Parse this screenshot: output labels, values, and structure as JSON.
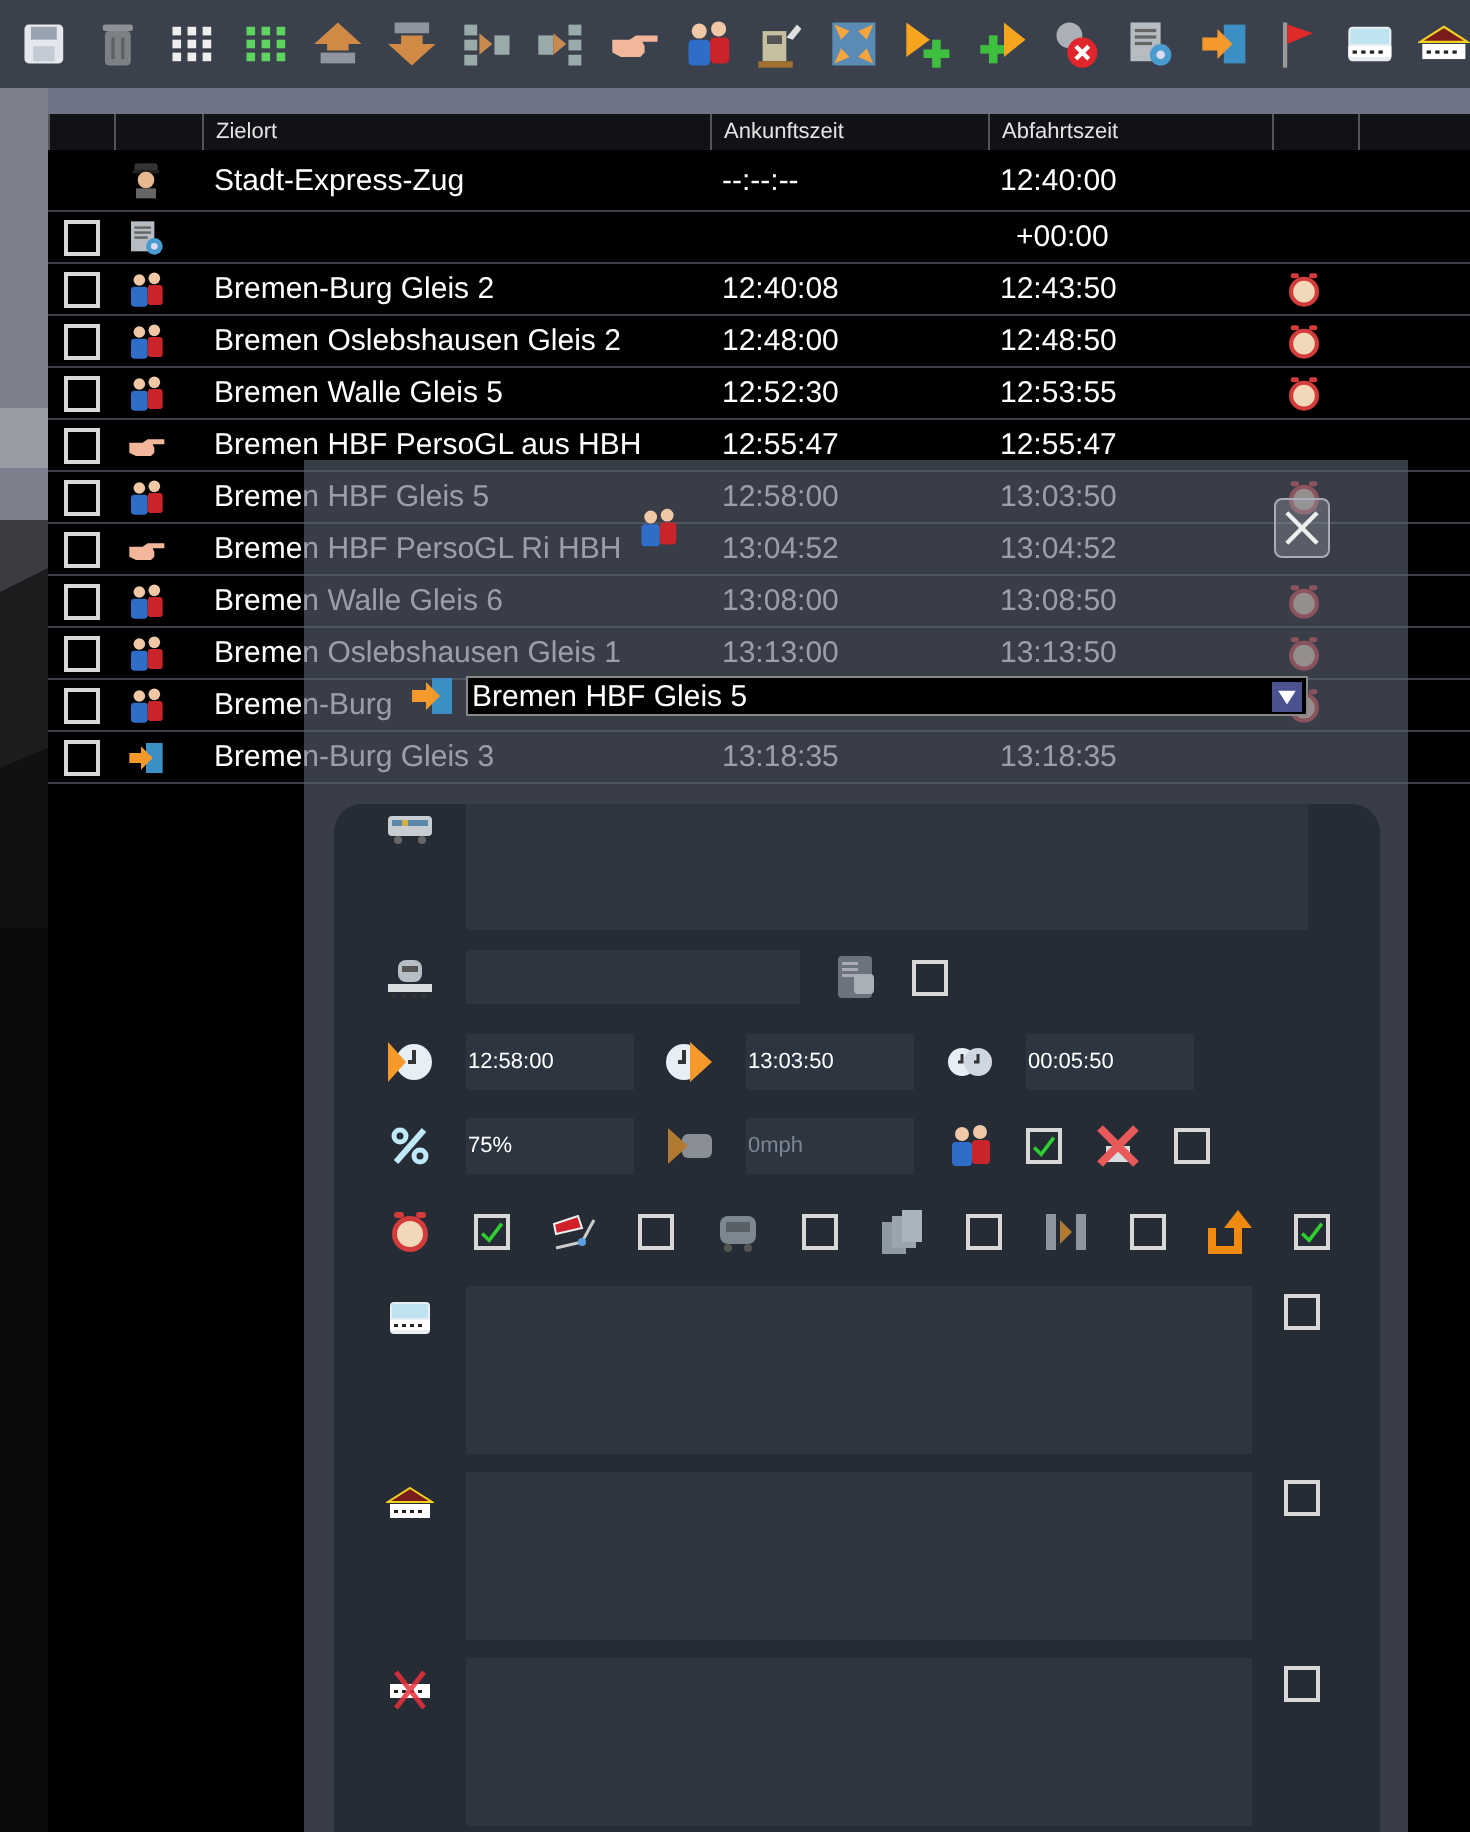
{
  "table": {
    "columns": [
      "Zielort",
      "Ankunftszeit",
      "Abfahrtszeit"
    ],
    "rows": [
      {
        "kind": "train",
        "destination": "Stadt-Express-Zug",
        "arrival": "--:--:--",
        "departure": "12:40:00",
        "alarm": false
      },
      {
        "kind": "settings",
        "checked": false,
        "departure": "+00:00",
        "alarm": false
      },
      {
        "kind": "passengers",
        "checked": false,
        "destination": "Bremen-Burg Gleis 2",
        "arrival": "12:40:08",
        "departure": "12:43:50",
        "alarm": true
      },
      {
        "kind": "passengers",
        "checked": false,
        "destination": "Bremen Oslebshausen Gleis 2",
        "arrival": "12:48:00",
        "departure": "12:48:50",
        "alarm": true
      },
      {
        "kind": "passengers",
        "checked": false,
        "destination": "Bremen Walle Gleis 5",
        "arrival": "12:52:30",
        "departure": "12:53:55",
        "alarm": true
      },
      {
        "kind": "pointer",
        "checked": false,
        "destination": "Bremen HBF PersoGL aus HBH",
        "arrival": "12:55:47",
        "departure": "12:55:47",
        "alarm": false
      },
      {
        "kind": "passengers",
        "checked": false,
        "destination": "Bremen HBF Gleis 5",
        "arrival": "12:58:00",
        "departure": "13:03:50",
        "alarm": true
      },
      {
        "kind": "pointer",
        "checked": false,
        "destination": "Bremen HBF PersoGL Ri HBH",
        "arrival": "13:04:52",
        "departure": "13:04:52",
        "alarm": false
      },
      {
        "kind": "passengers",
        "checked": false,
        "destination": "Bremen Walle Gleis 6",
        "arrival": "13:08:00",
        "departure": "13:08:50",
        "alarm": true
      },
      {
        "kind": "passengers",
        "checked": false,
        "destination": "Bremen Oslebshausen Gleis 1",
        "arrival": "13:13:00",
        "departure": "13:13:50",
        "alarm": true
      },
      {
        "kind": "passengers",
        "checked": false,
        "destination": "Bremen-Burg",
        "alarm": true
      },
      {
        "kind": "exit",
        "checked": false,
        "destination": "Bremen-Burg Gleis 3",
        "arrival": "13:18:35",
        "departure": "13:18:35",
        "alarm": false
      }
    ]
  },
  "panel": {
    "destination": {
      "value": "Bremen HBF Gleis 5"
    },
    "times": [
      {
        "kind": "arrival",
        "value": "12:58:00"
      },
      {
        "kind": "departure",
        "value": "13:03:50"
      },
      {
        "kind": "duration",
        "value": "00:05:50"
      }
    ],
    "percent": {
      "value": "75%"
    },
    "speed": {
      "placeholder": "0mph"
    },
    "flags": [
      {
        "kind": "composition",
        "checked": false
      },
      {
        "kind": "passengers",
        "checked": true
      },
      {
        "kind": "cancel",
        "checked": false
      },
      {
        "kind": "alarm",
        "checked": true
      },
      {
        "kind": "coupler",
        "checked": false
      },
      {
        "kind": "wagon",
        "checked": false
      },
      {
        "kind": "pages",
        "checked": false
      },
      {
        "kind": "skip",
        "checked": false
      },
      {
        "kind": "reverse",
        "checked": true
      }
    ],
    "notes": [
      {
        "kind": "platform",
        "checked": false
      },
      {
        "kind": "station",
        "checked": false
      },
      {
        "kind": "no-platform",
        "checked": false
      }
    ]
  }
}
